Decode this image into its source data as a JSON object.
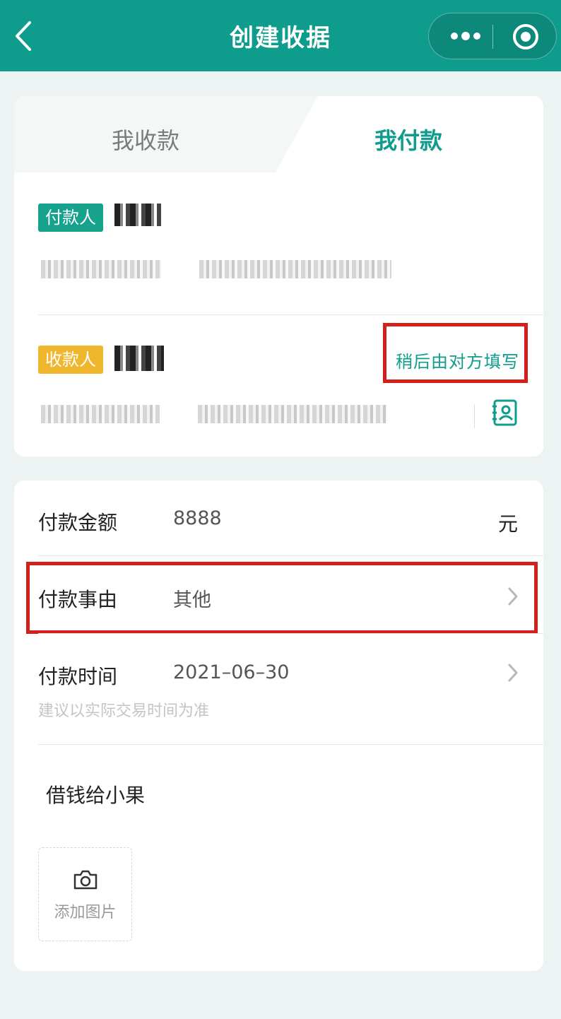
{
  "navbar": {
    "title": "创建收据",
    "back_icon": "chevron-left-icon",
    "more_icon": "more-dots-icon",
    "close_icon": "target-circle-icon"
  },
  "tabs": [
    {
      "label": "我收款",
      "active": false
    },
    {
      "label": "我付款",
      "active": true
    }
  ],
  "payer": {
    "badge": "付款人",
    "badge_color": "#16a28d"
  },
  "payee": {
    "badge": "收款人",
    "badge_color": "#f0b72c",
    "later_link": "稍后由对方填写"
  },
  "form": {
    "amount": {
      "label": "付款金额",
      "value": "8888",
      "unit": "元"
    },
    "reason": {
      "label": "付款事由",
      "value": "其他"
    },
    "time": {
      "label": "付款时间",
      "value": "2021–06–30",
      "hint": "建议以实际交易时间为准"
    },
    "remark": "借钱给小果",
    "upload_label": "添加图片"
  },
  "colors": {
    "primary": "#0e9c8c",
    "highlight": "#d3201a"
  }
}
